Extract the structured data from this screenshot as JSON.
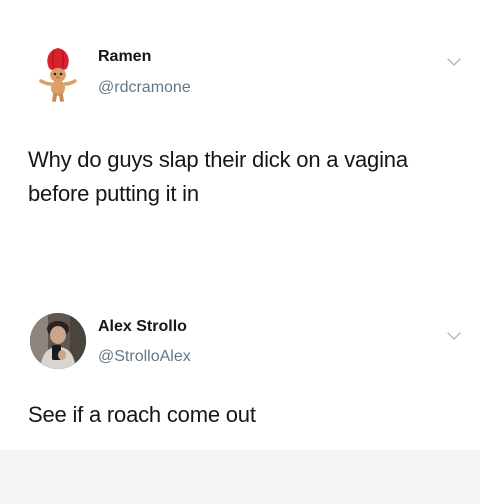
{
  "tweets": [
    {
      "name": "Ramen",
      "handle": "@rdcramone",
      "text_lines": [
        "Why do guys slap their dick on a vagina",
        "before putting it in"
      ],
      "avatar_icon": "troll-doll-avatar-icon",
      "menu_icon": "chevron-down-icon"
    },
    {
      "name": "Alex Strollo",
      "handle": "@StrolloAlex",
      "text_lines": [
        "See if a roach come out"
      ],
      "avatar_icon": "user-photo-avatar-icon",
      "menu_icon": "chevron-down-icon"
    }
  ],
  "colors": {
    "name": "#14171a",
    "handle": "#657786",
    "chevron": "#aab8c2",
    "background": "#ffffff"
  }
}
